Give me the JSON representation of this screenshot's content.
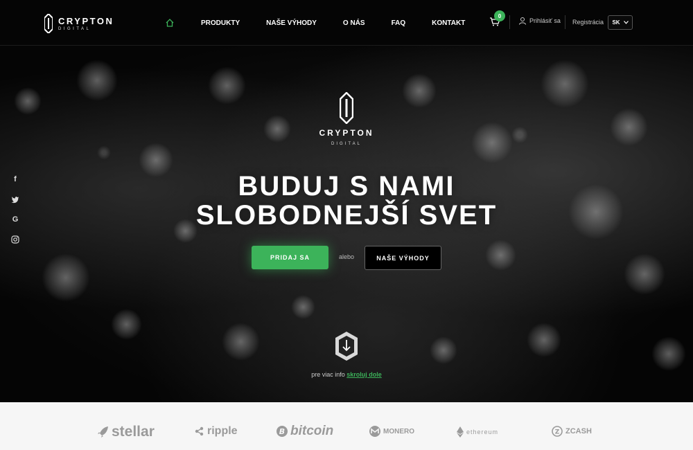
{
  "brand": {
    "name": "CRYPTON",
    "sub": "DIGITAL"
  },
  "nav": {
    "home_icon": "home-icon",
    "items": [
      "PRODUKTY",
      "NAŠE VÝHODY",
      "O NÁS",
      "FAQ",
      "KONTAKT"
    ]
  },
  "header": {
    "cart_count": "0",
    "login_label": "Prihlásiť sa",
    "register_label": "Registrácia",
    "language": "SK"
  },
  "hero": {
    "headline_line1": "BUDUJ S NAMI",
    "headline_line2": "SLOBODNEJŠÍ SVET",
    "join_label": "PRIDAJ SA",
    "or_label": "alebo",
    "advantages_label": "NAŠE VÝHODY",
    "scroll_text": "pre viac info",
    "scroll_link": "skroluj dole"
  },
  "socials": [
    "facebook-icon",
    "twitter-icon",
    "google-icon",
    "instagram-icon"
  ],
  "partners": [
    "stellar",
    "ripple",
    "bitcoin",
    "MONERO",
    "ethereum",
    "ZCASH"
  ],
  "colors": {
    "accent": "#3cb35a",
    "background": "#000000",
    "partners_bg": "#f6f6f6"
  }
}
